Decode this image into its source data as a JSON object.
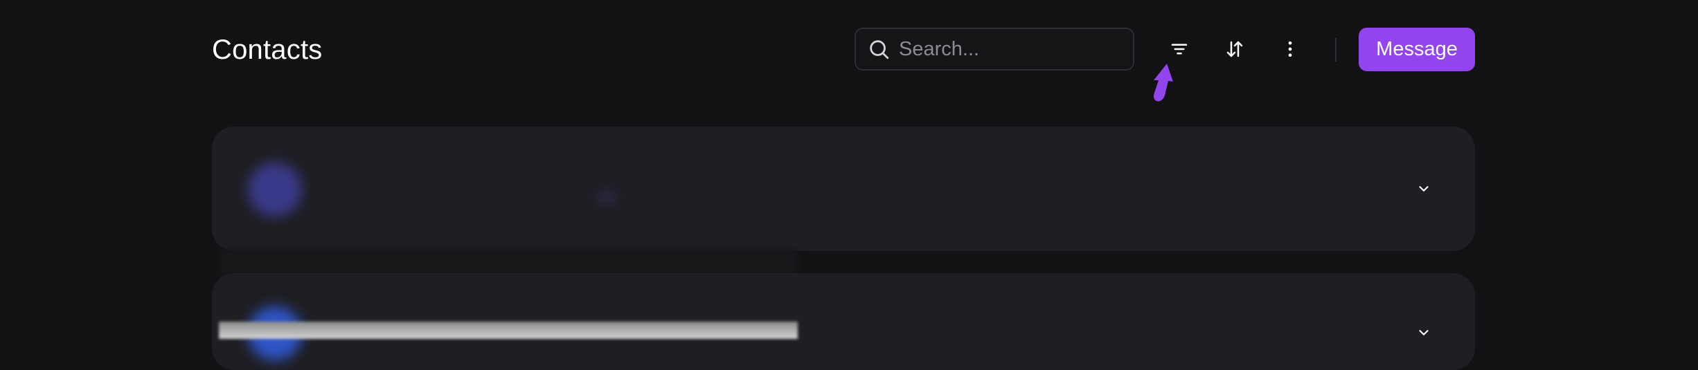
{
  "header": {
    "title": "Contacts",
    "search_placeholder": "Search...",
    "primary_button_label": "Message"
  },
  "icons": {
    "search": "search-icon",
    "filter": "filter-icon",
    "sort": "sort-icon",
    "more": "more-vertical-icon",
    "chevron": "chevron-down-icon",
    "cursor": "hand-pointer-icon"
  },
  "colors": {
    "accent": "#9245ec",
    "background": "#121214",
    "card": "#1e1e23"
  },
  "contacts": [
    {
      "name": "",
      "email": "",
      "tag": ""
    },
    {
      "name": "",
      "email": "",
      "tag": ""
    }
  ]
}
